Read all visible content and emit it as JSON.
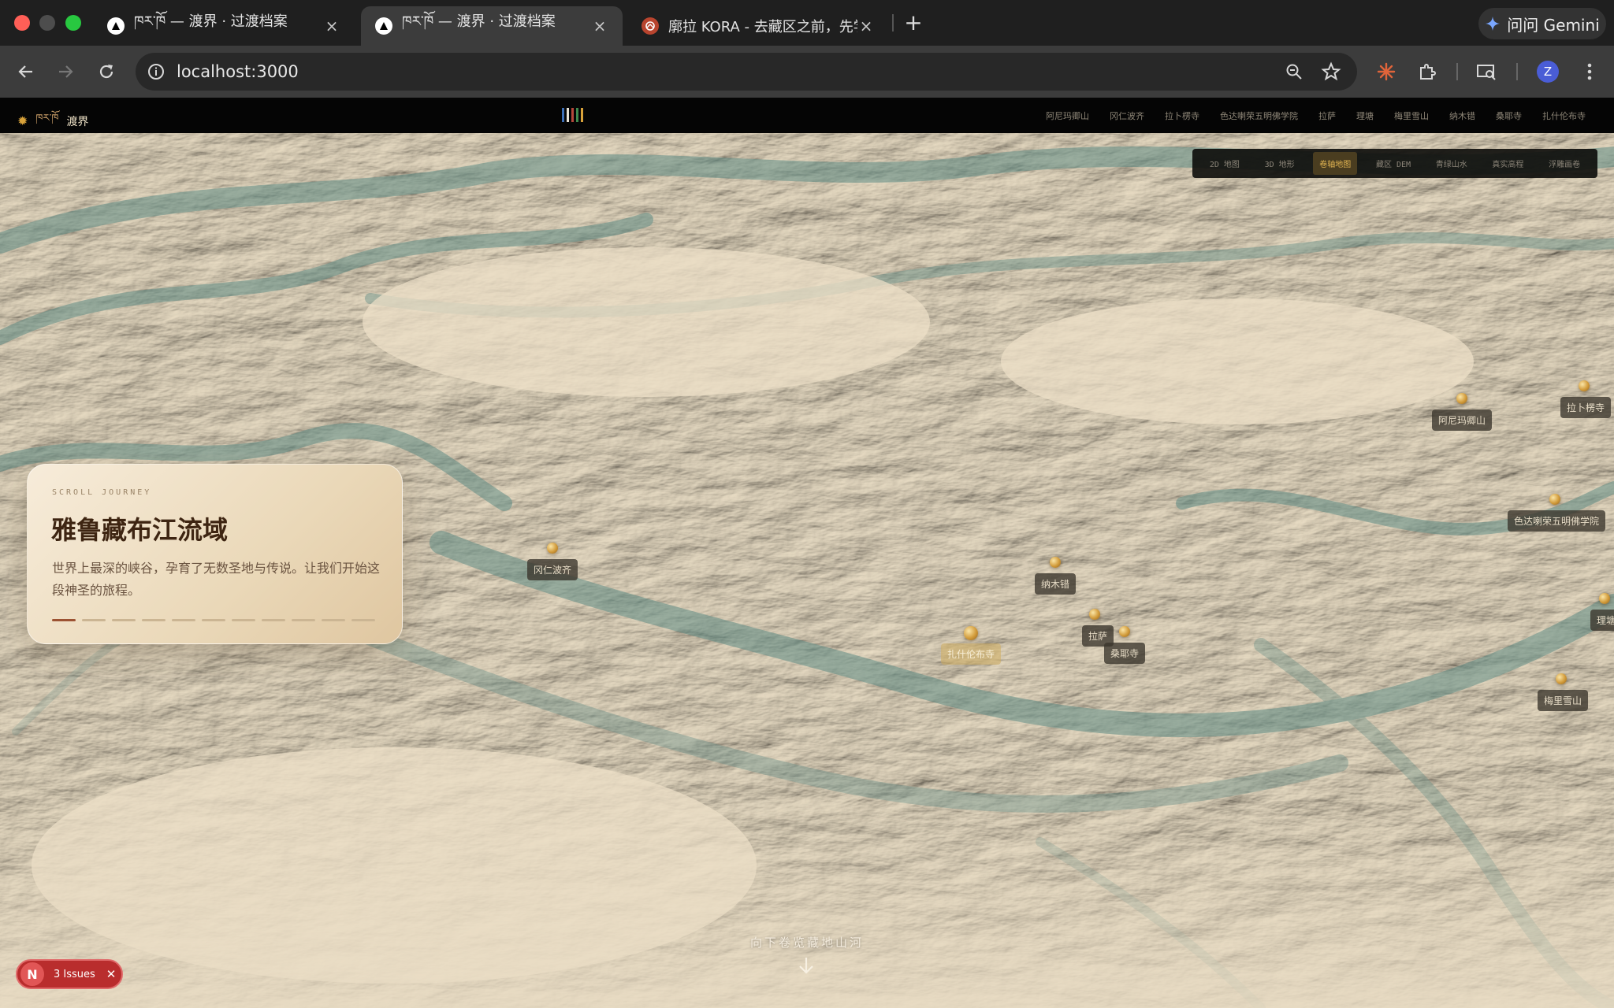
{
  "browser": {
    "tabs": [
      {
        "title": "ཁར་ཁོ — 渡界 · 过渡档案",
        "favicon": "triangle-icon"
      },
      {
        "title": "ཁར་ཁོ — 渡界 · 过渡档案",
        "favicon": "triangle-icon"
      },
      {
        "title": "廓拉 KORA - 去藏区之前，先学",
        "favicon": "kora-icon"
      }
    ],
    "active_tab": 1,
    "url": "localhost:3000",
    "gemini_label": "问问 Gemini",
    "avatar_letter": "Z"
  },
  "site": {
    "brand_tibetan": "ཁར་ཁོ",
    "brand_name": "渡界",
    "nav_links": [
      "阿尼玛卿山",
      "冈仁波齐",
      "拉卜楞寺",
      "色达喇荣五明佛学院",
      "拉萨",
      "理塘",
      "梅里雪山",
      "纳木错",
      "桑耶寺",
      "扎什伦布寺"
    ],
    "view_modes": [
      "2D 地图",
      "3D 地形",
      "卷轴地图",
      "藏区 DEM",
      "青绿山水",
      "真实高程",
      "浮雕画卷"
    ],
    "active_mode": 2
  },
  "card": {
    "kicker": "SCROLL JOURNEY",
    "title": "雅鲁藏布江流域",
    "body": "世界上最深的峡谷，孕育了无数圣地与传说。让我们开始这段神圣的旅程。",
    "progress_total": 11,
    "progress_current": 1
  },
  "markers": [
    {
      "label": "冈仁波齐"
    },
    {
      "label": "纳木错"
    },
    {
      "label": "扎什伦布寺"
    },
    {
      "label": "拉萨"
    },
    {
      "label": "桑耶寺"
    },
    {
      "label": "阿尼玛卿山"
    },
    {
      "label": "拉卜楞寺"
    },
    {
      "label": "色达喇荣五明佛学院"
    },
    {
      "label": "理塘"
    },
    {
      "label": "梅里雪山"
    }
  ],
  "scroll_hint": "向下卷览藏地山河",
  "dev_badge": {
    "letter": "N",
    "text": "3 Issues"
  },
  "colors": {
    "accent_gold": "#e2b552",
    "issue_red": "#b92d2d",
    "map_sand": "#e5d7be",
    "map_teal": "#5f8c86"
  }
}
